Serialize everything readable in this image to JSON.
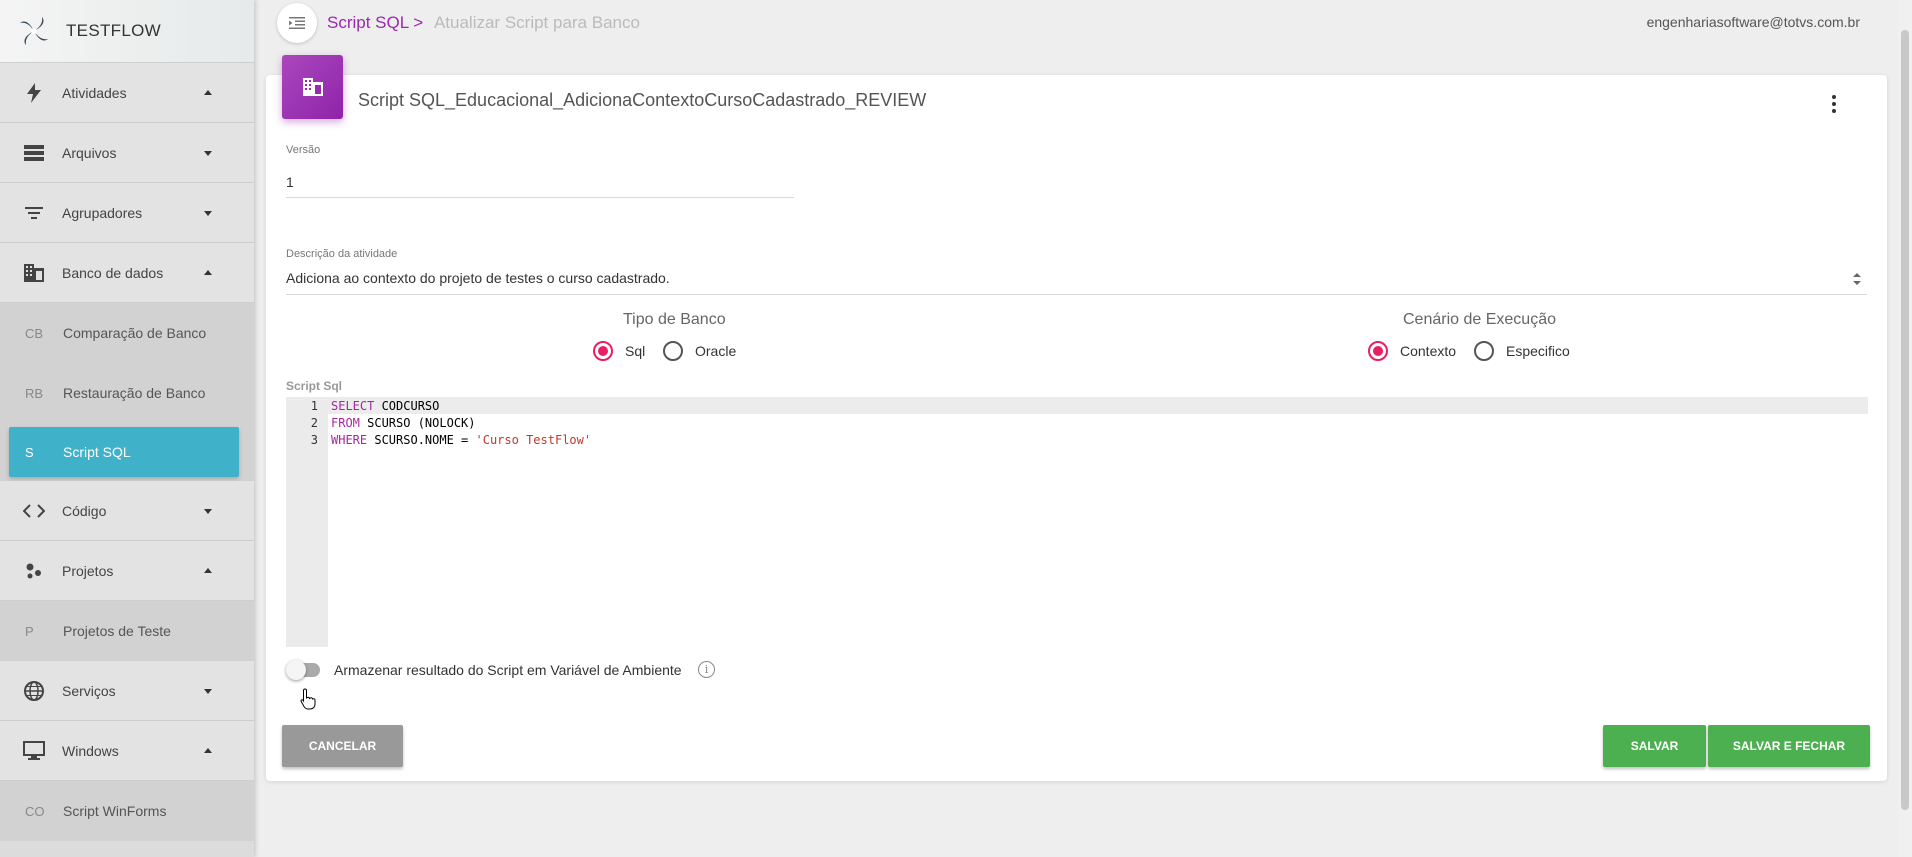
{
  "app": {
    "name": "TESTFLOW"
  },
  "sidebar": {
    "groups": [
      {
        "label": "Atividades",
        "icon": "lightning-icon",
        "state": "expanded"
      },
      {
        "label": "Arquivos",
        "icon": "storage-icon",
        "state": "collapsed"
      },
      {
        "label": "Agrupadores",
        "icon": "filter-list-icon",
        "state": "collapsed"
      },
      {
        "label": "Banco de dados",
        "icon": "building-icon",
        "state": "expanded",
        "items": [
          {
            "abbr": "CB",
            "label": "Comparação de Banco"
          },
          {
            "abbr": "RB",
            "label": "Restauração de Banco"
          },
          {
            "abbr": "S",
            "label": "Script SQL",
            "active": true
          }
        ]
      },
      {
        "label": "Código",
        "icon": "code-icon",
        "state": "collapsed"
      },
      {
        "label": "Projetos",
        "icon": "bubbles-icon",
        "state": "expanded",
        "items": [
          {
            "abbr": "P",
            "label": "Projetos de Teste"
          }
        ]
      },
      {
        "label": "Serviços",
        "icon": "globe-icon",
        "state": "collapsed"
      },
      {
        "label": "Windows",
        "icon": "monitor-icon",
        "state": "expanded",
        "items": [
          {
            "abbr": "CO",
            "label": "Script WinForms"
          }
        ]
      }
    ]
  },
  "header": {
    "breadcrumb_parent": "Script SQL >",
    "breadcrumb_current": "Atualizar Script para Banco",
    "user_email": "engenhariasoftware@totvs.com.br"
  },
  "card": {
    "title": "Script SQL_Educacional_AdicionaContextoCursoCadastrado_REVIEW",
    "version_label": "Versão",
    "version_value": "1",
    "description_label": "Descrição da atividade",
    "description_value": "Adiciona ao contexto do projeto de testes o curso cadastrado.",
    "db_type": {
      "title": "Tipo de Banco",
      "options": [
        "Sql",
        "Oracle"
      ],
      "selected": "Sql"
    },
    "scenario": {
      "title": "Cenário de Execução",
      "options": [
        "Contexto",
        "Especifico"
      ],
      "selected": "Contexto"
    },
    "script_label": "Script Sql",
    "script_lines": [
      {
        "n": "1",
        "kw": "SELECT",
        "rest": " CODCURSO"
      },
      {
        "n": "2",
        "kw": "FROM",
        "rest": " SCURSO (NOLOCK)"
      },
      {
        "n": "3",
        "kw": "WHERE",
        "rest": " SCURSO.NOME = ",
        "str": "'Curso TestFlow'"
      }
    ],
    "store_result_label": "Armazenar resultado do Script em Variável de Ambiente",
    "store_result_enabled": false,
    "info_icon_glyph": "i"
  },
  "actions": {
    "cancel": "CANCELAR",
    "save": "SALVAR",
    "save_close": "SALVAR E FECHAR"
  },
  "colors": {
    "accent_purple": "#9c27b0",
    "active_nav": "#3fb1c9",
    "radio_selected": "#e91e63",
    "save_green": "#4caf50"
  }
}
